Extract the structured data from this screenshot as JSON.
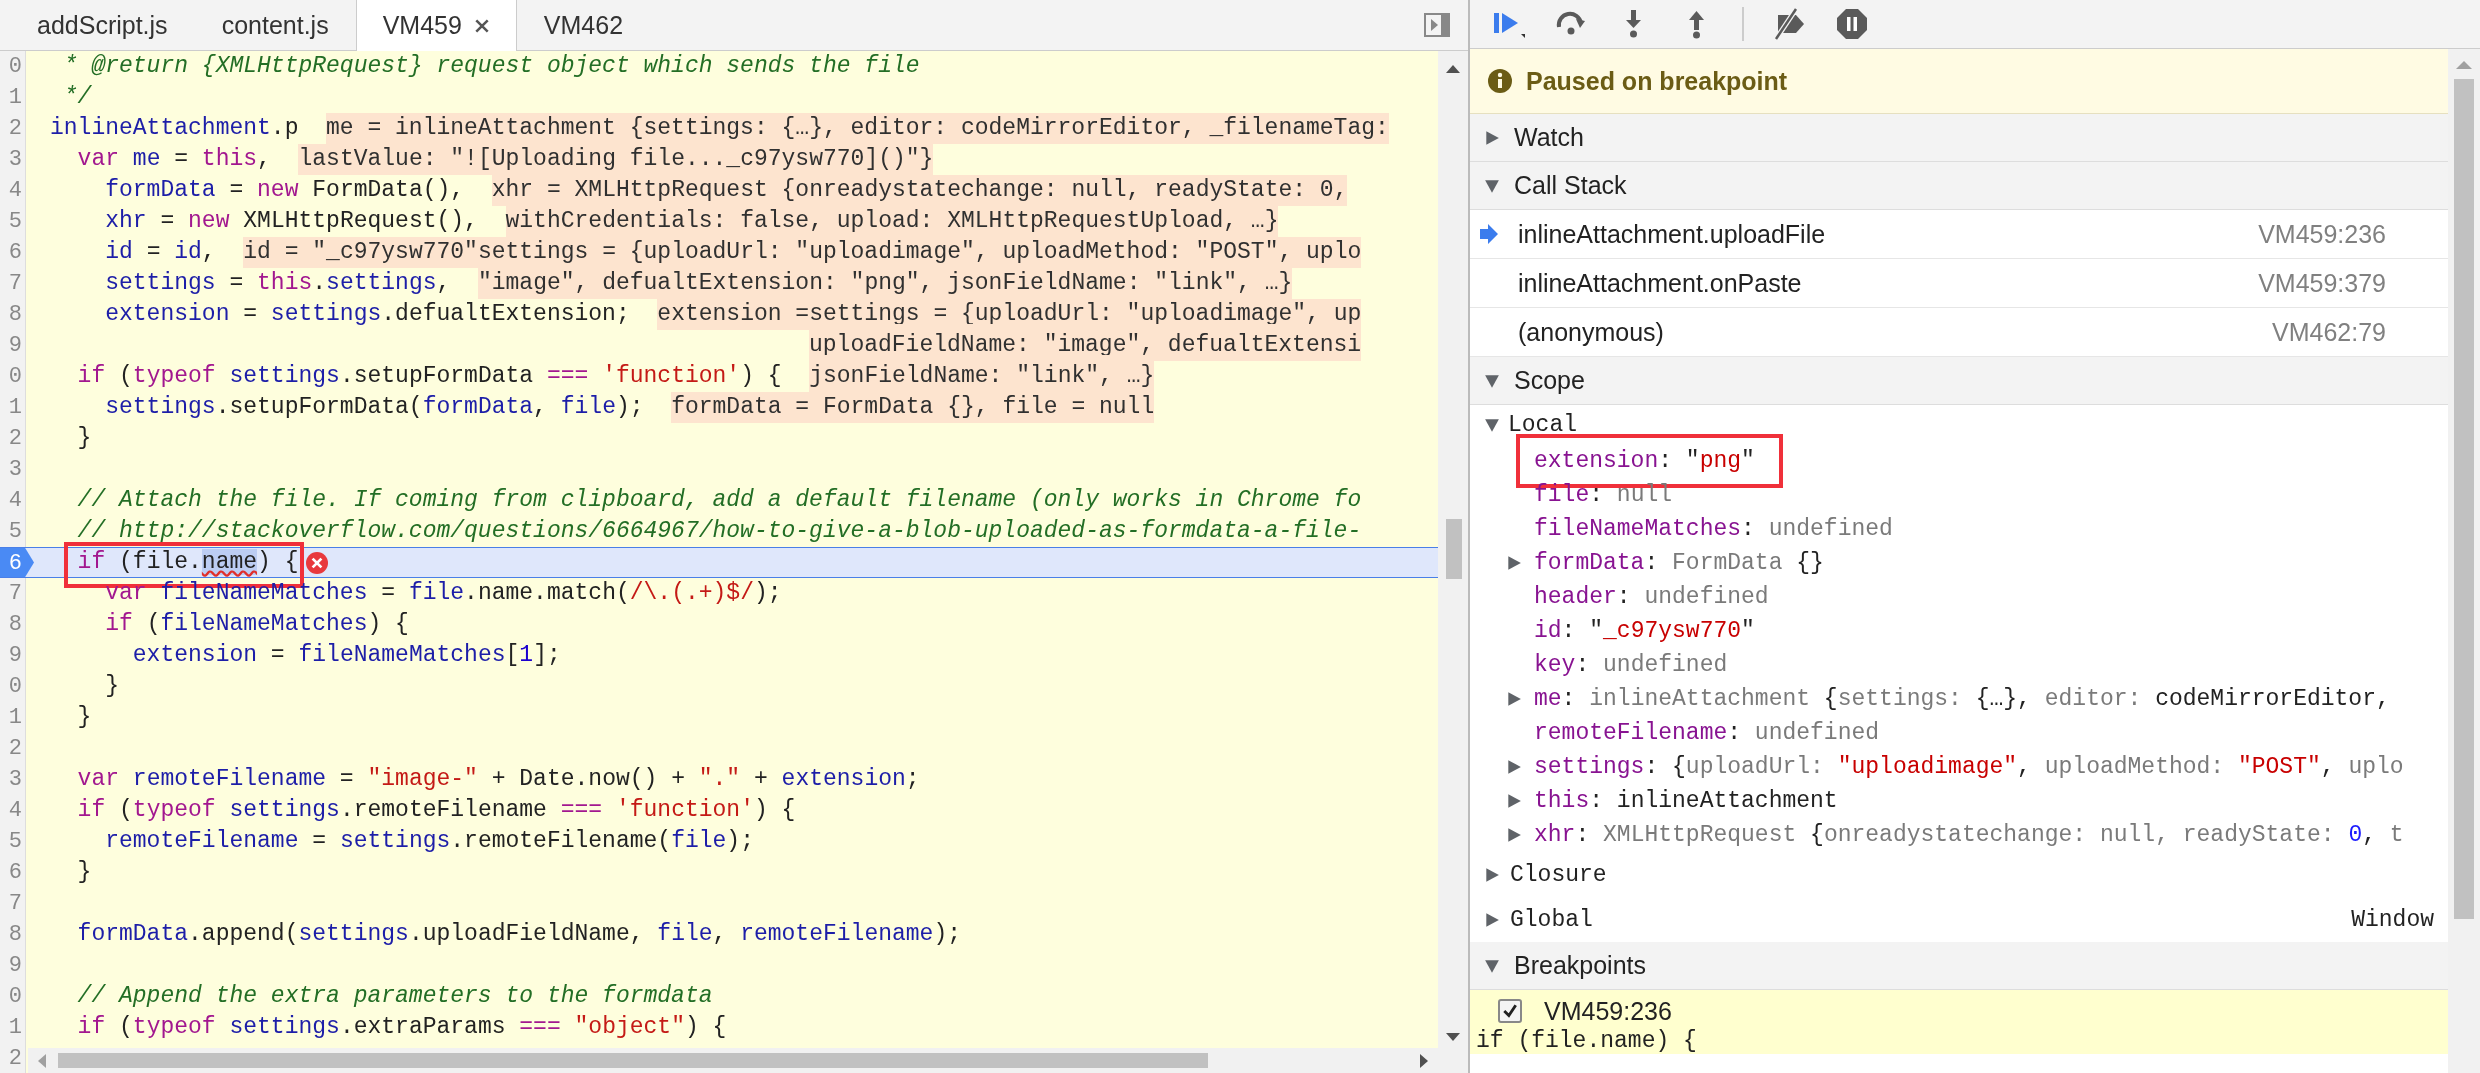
{
  "editor": {
    "tabs": [
      {
        "label": "addScript.js",
        "selected": false,
        "closable": false
      },
      {
        "label": "content.js",
        "selected": false,
        "closable": false
      },
      {
        "label": "VM459",
        "selected": true,
        "closable": true
      },
      {
        "label": "VM462",
        "selected": false,
        "closable": false
      }
    ],
    "code_lines": [
      {
        "gutter": "0",
        "tokens": [
          {
            "kind": "cm",
            "text": " * @return {XMLHttpRequest} request object which sends the file"
          }
        ]
      },
      {
        "gutter": "1",
        "tokens": [
          {
            "kind": "cm",
            "text": " */"
          }
        ]
      },
      {
        "gutter": "2",
        "tokens": [
          {
            "kind": "id",
            "text": "inlineAttachment"
          },
          {
            "kind": "p",
            "text": ".p"
          }
        ],
        "values": [
          {
            "text": "me = inlineAttachment {settings: {…}, editor: codeMirrorEditor, _filenameTag:",
            "continues": false
          }
        ]
      },
      {
        "gutter": "3",
        "tokens": [
          {
            "kind": "kw",
            "text": "  var "
          },
          {
            "kind": "id",
            "text": "me"
          },
          {
            "kind": "p",
            "text": " = "
          },
          {
            "kind": "kw",
            "text": "this"
          },
          {
            "kind": "p",
            "text": ","
          }
        ],
        "values": [
          {
            "text": "lastValue: \"![Uploading file..._c97ysw770]()\"}",
            "continues": false
          }
        ]
      },
      {
        "gutter": "4",
        "tokens": [
          {
            "kind": "id",
            "text": "    formData"
          },
          {
            "kind": "p",
            "text": " = "
          },
          {
            "kind": "kw",
            "text": "new"
          },
          {
            "kind": "p",
            "text": " FormData(),"
          }
        ],
        "values": [
          {
            "text": "xhr = XMLHttpRequest {onreadystatechange: null, readyState: 0,",
            "continues": false
          }
        ]
      },
      {
        "gutter": "5",
        "tokens": [
          {
            "kind": "id",
            "text": "    xhr"
          },
          {
            "kind": "p",
            "text": " = "
          },
          {
            "kind": "kw",
            "text": "new"
          },
          {
            "kind": "p",
            "text": " XMLHttpRequest(),"
          }
        ],
        "values": [
          {
            "text": "withCredentials: false, upload: XMLHttpRequestUpload, …}",
            "continues": false
          }
        ]
      },
      {
        "gutter": "6",
        "tokens": [
          {
            "kind": "id",
            "text": "    id"
          },
          {
            "kind": "p",
            "text": " = "
          },
          {
            "kind": "id",
            "text": "id"
          },
          {
            "kind": "p",
            "text": ","
          }
        ],
        "values": [
          {
            "text": "id = \"_c97ysw770\"",
            "continues": false
          },
          {
            "text": "settings = {uploadUrl: \"uploadimage\", uploadMethod: \"POST\", uplo",
            "continues": false
          }
        ]
      },
      {
        "gutter": "7",
        "tokens": [
          {
            "kind": "id",
            "text": "    settings"
          },
          {
            "kind": "p",
            "text": " = "
          },
          {
            "kind": "kw",
            "text": "this"
          },
          {
            "kind": "p",
            "text": "."
          },
          {
            "kind": "id",
            "text": "settings"
          },
          {
            "kind": "p",
            "text": ","
          }
        ],
        "values": [
          {
            "text": "\"image\", defualtExtension: \"png\", jsonFieldName: \"link\", …}",
            "continues": false
          }
        ]
      },
      {
        "gutter": "8",
        "tokens": [
          {
            "kind": "id",
            "text": "    extension"
          },
          {
            "kind": "p",
            "text": " = "
          },
          {
            "kind": "id",
            "text": "settings"
          },
          {
            "kind": "p",
            "text": ".defualtExtension;"
          }
        ],
        "values": [
          {
            "text": "extension =",
            "continues": false
          },
          {
            "text": "settings = {uploadUrl: \"uploadimage\", up",
            "continues": false
          }
        ]
      },
      {
        "gutter": "9",
        "values": [
          {
            "text": "uploadFieldName: \"image\", defualtExtensi",
            "continues": true
          }
        ]
      },
      {
        "gutter": "0",
        "tokens": [
          {
            "kind": "kw",
            "text": "  if"
          },
          {
            "kind": "p",
            "text": " ("
          },
          {
            "kind": "kw",
            "text": "typeof "
          },
          {
            "kind": "id",
            "text": "settings"
          },
          {
            "kind": "p",
            "text": ".setupFormData "
          },
          {
            "kind": "kw",
            "text": "=== "
          },
          {
            "kind": "str",
            "text": "'function'"
          },
          {
            "kind": "p",
            "text": ") {"
          }
        ],
        "values": [
          {
            "text": "jsonFieldName: \"link\", …}",
            "continues": true
          }
        ]
      },
      {
        "gutter": "1",
        "tokens": [
          {
            "kind": "id",
            "text": "    settings"
          },
          {
            "kind": "p",
            "text": ".setupFormData("
          },
          {
            "kind": "id",
            "text": "formData"
          },
          {
            "kind": "p",
            "text": ", "
          },
          {
            "kind": "id",
            "text": "file"
          },
          {
            "kind": "p",
            "text": ");"
          }
        ],
        "values": [
          {
            "text": "formData = FormData {}, file = null",
            "continues": false
          }
        ]
      },
      {
        "gutter": "2",
        "tokens": [
          {
            "kind": "p",
            "text": "  }"
          }
        ]
      },
      {
        "gutter": "3"
      },
      {
        "gutter": "4",
        "tokens": [
          {
            "kind": "cm",
            "text": "  // Attach the file. If coming from clipboard, add a default filename (only works in Chrome fo"
          }
        ]
      },
      {
        "gutter": "5",
        "tokens": [
          {
            "kind": "cm",
            "text": "  // http://stackoverflow.com/questions/6664967/how-to-give-a-blob-uploaded-as-formdata-a-file-"
          }
        ]
      },
      {
        "gutter": "6",
        "tokens": [
          {
            "kind": "kw",
            "text": "  if"
          },
          {
            "kind": "p",
            "text": " (file."
          },
          {
            "kind": "selected",
            "text": "name"
          },
          {
            "kind": "p",
            "text": ") {"
          }
        ],
        "current": true,
        "breakpoint": true,
        "error": true,
        "annotated": true
      },
      {
        "gutter": "7",
        "tokens": [
          {
            "kind": "kw",
            "text": "    var "
          },
          {
            "kind": "id",
            "text": "fileNameMatches"
          },
          {
            "kind": "p",
            "text": " = "
          },
          {
            "kind": "id",
            "text": "file"
          },
          {
            "kind": "p",
            "text": ".name.match("
          },
          {
            "kind": "str",
            "text": "/\\.(.+)$/"
          },
          {
            "kind": "p",
            "text": ");"
          }
        ]
      },
      {
        "gutter": "8",
        "tokens": [
          {
            "kind": "kw",
            "text": "    if"
          },
          {
            "kind": "p",
            "text": " ("
          },
          {
            "kind": "id",
            "text": "fileNameMatches"
          },
          {
            "kind": "p",
            "text": ") {"
          }
        ]
      },
      {
        "gutter": "9",
        "tokens": [
          {
            "kind": "id",
            "text": "      extension"
          },
          {
            "kind": "p",
            "text": " = "
          },
          {
            "kind": "id",
            "text": "fileNameMatches"
          },
          {
            "kind": "p",
            "text": "["
          },
          {
            "kind": "num",
            "text": "1"
          },
          {
            "kind": "p",
            "text": "];"
          }
        ]
      },
      {
        "gutter": "0",
        "tokens": [
          {
            "kind": "p",
            "text": "    }"
          }
        ]
      },
      {
        "gutter": "1",
        "tokens": [
          {
            "kind": "p",
            "text": "  }"
          }
        ]
      },
      {
        "gutter": "2"
      },
      {
        "gutter": "3",
        "tokens": [
          {
            "kind": "kw",
            "text": "  var "
          },
          {
            "kind": "id",
            "text": "remoteFilename"
          },
          {
            "kind": "p",
            "text": " = "
          },
          {
            "kind": "str",
            "text": "\"image-\""
          },
          {
            "kind": "p",
            "text": " + Date.now() + "
          },
          {
            "kind": "str",
            "text": "\".\""
          },
          {
            "kind": "p",
            "text": " + "
          },
          {
            "kind": "id",
            "text": "extension"
          },
          {
            "kind": "p",
            "text": ";"
          }
        ]
      },
      {
        "gutter": "4",
        "tokens": [
          {
            "kind": "kw",
            "text": "  if"
          },
          {
            "kind": "p",
            "text": " ("
          },
          {
            "kind": "kw",
            "text": "typeof "
          },
          {
            "kind": "id",
            "text": "settings"
          },
          {
            "kind": "p",
            "text": ".remoteFilename "
          },
          {
            "kind": "kw",
            "text": "=== "
          },
          {
            "kind": "str",
            "text": "'function'"
          },
          {
            "kind": "p",
            "text": ") {"
          }
        ]
      },
      {
        "gutter": "5",
        "tokens": [
          {
            "kind": "id",
            "text": "    remoteFilename"
          },
          {
            "kind": "p",
            "text": " = "
          },
          {
            "kind": "id",
            "text": "settings"
          },
          {
            "kind": "p",
            "text": ".remoteFilename("
          },
          {
            "kind": "id",
            "text": "file"
          },
          {
            "kind": "p",
            "text": ");"
          }
        ]
      },
      {
        "gutter": "6",
        "tokens": [
          {
            "kind": "p",
            "text": "  }"
          }
        ]
      },
      {
        "gutter": "7"
      },
      {
        "gutter": "8",
        "tokens": [
          {
            "kind": "id",
            "text": "  formData"
          },
          {
            "kind": "p",
            "text": ".append("
          },
          {
            "kind": "id",
            "text": "settings"
          },
          {
            "kind": "p",
            "text": ".uploadFieldName, "
          },
          {
            "kind": "id",
            "text": "file"
          },
          {
            "kind": "p",
            "text": ", "
          },
          {
            "kind": "id",
            "text": "remoteFilename"
          },
          {
            "kind": "p",
            "text": ");"
          }
        ]
      },
      {
        "gutter": "9"
      },
      {
        "gutter": "0",
        "tokens": [
          {
            "kind": "cm",
            "text": "  // Append the extra parameters to the formdata"
          }
        ]
      },
      {
        "gutter": "1",
        "tokens": [
          {
            "kind": "kw",
            "text": "  if"
          },
          {
            "kind": "p",
            "text": " ("
          },
          {
            "kind": "kw",
            "text": "typeof "
          },
          {
            "kind": "id",
            "text": "settings"
          },
          {
            "kind": "p",
            "text": ".extraParams "
          },
          {
            "kind": "kw",
            "text": "=== "
          },
          {
            "kind": "str",
            "text": "\"object\""
          },
          {
            "kind": "p",
            "text": ") {"
          }
        ]
      },
      {
        "gutter": "2"
      }
    ]
  },
  "debugger": {
    "toolbar": [
      {
        "kind": "resume"
      },
      {
        "kind": "step_over"
      },
      {
        "kind": "step_into"
      },
      {
        "kind": "step_out"
      },
      {
        "kind": "separator"
      },
      {
        "kind": "deactivate"
      },
      {
        "kind": "pause_exceptions"
      }
    ],
    "status": "Paused on breakpoint",
    "sections": [
      {
        "kind": "watch",
        "title": "Watch",
        "expanded": false
      },
      {
        "kind": "call_stack",
        "title": "Call Stack",
        "expanded": true,
        "frames": [
          {
            "name": "inlineAttachment.uploadFile",
            "location": "VM459:236",
            "selected": true
          },
          {
            "name": "inlineAttachment.onPaste",
            "location": "VM459:379",
            "selected": false
          },
          {
            "name": "(anonymous)",
            "location": "VM462:79",
            "selected": false
          }
        ]
      },
      {
        "kind": "scope",
        "title": "Scope",
        "expanded": true,
        "scopes": [
          {
            "title": "Local",
            "expanded": true,
            "variables": [
              {
                "name": "extension",
                "value": [
                  {
                    "kind": "p",
                    "text": ": \""
                  },
                  {
                    "kind": "str",
                    "text": "png"
                  },
                  {
                    "kind": "p",
                    "text": "\""
                  }
                ],
                "annotated": true
              },
              {
                "name": "file",
                "value": [
                  {
                    "kind": "p",
                    "text": ": "
                  },
                  {
                    "kind": "dim",
                    "text": "null"
                  }
                ],
                "annotated": false
              },
              {
                "name": "fileNameMatches",
                "value": [
                  {
                    "kind": "p",
                    "text": ": "
                  },
                  {
                    "kind": "dim",
                    "text": "undefined"
                  }
                ],
                "annotated": false
              },
              {
                "name": "formData",
                "value": [
                  {
                    "kind": "p",
                    "text": ": "
                  },
                  {
                    "kind": "dim",
                    "text": "FormData "
                  },
                  {
                    "kind": "p",
                    "text": "{}"
                  }
                ],
                "expanded": false,
                "annotated": false
              },
              {
                "name": "header",
                "value": [
                  {
                    "kind": "p",
                    "text": ": "
                  },
                  {
                    "kind": "dim",
                    "text": "undefined"
                  }
                ],
                "annotated": false
              },
              {
                "name": "id",
                "value": [
                  {
                    "kind": "p",
                    "text": ": \""
                  },
                  {
                    "kind": "str",
                    "text": "_c97ysw770"
                  },
                  {
                    "kind": "p",
                    "text": "\""
                  }
                ],
                "annotated": false
              },
              {
                "name": "key",
                "value": [
                  {
                    "kind": "p",
                    "text": ": "
                  },
                  {
                    "kind": "dim",
                    "text": "undefined"
                  }
                ],
                "annotated": false
              },
              {
                "name": "me",
                "value": [
                  {
                    "kind": "p",
                    "text": ": "
                  },
                  {
                    "kind": "dim",
                    "text": "inlineAttachment "
                  },
                  {
                    "kind": "p",
                    "text": "{"
                  },
                  {
                    "kind": "dim",
                    "text": "settings: "
                  },
                  {
                    "kind": "p",
                    "text": "{…}, "
                  },
                  {
                    "kind": "dim",
                    "text": "editor: "
                  },
                  {
                    "kind": "p",
                    "text": "codeMirrorEditor,"
                  }
                ],
                "expanded": false,
                "annotated": false
              },
              {
                "name": "remoteFilename",
                "value": [
                  {
                    "kind": "p",
                    "text": ": "
                  },
                  {
                    "kind": "dim",
                    "text": "undefined"
                  }
                ],
                "annotated": false
              },
              {
                "name": "settings",
                "value": [
                  {
                    "kind": "p",
                    "text": ": {"
                  },
                  {
                    "kind": "dim",
                    "text": "uploadUrl: "
                  },
                  {
                    "kind": "str",
                    "text": "\"uploadimage\""
                  },
                  {
                    "kind": "p",
                    "text": ", "
                  },
                  {
                    "kind": "dim",
                    "text": "uploadMethod: "
                  },
                  {
                    "kind": "str",
                    "text": "\"POST\""
                  },
                  {
                    "kind": "p",
                    "text": ", "
                  },
                  {
                    "kind": "dim",
                    "text": "uplo"
                  }
                ],
                "expanded": false,
                "annotated": false
              },
              {
                "name": "this",
                "value": [
                  {
                    "kind": "p",
                    "text": ": inlineAttachment"
                  }
                ],
                "expanded": false,
                "annotated": false
              },
              {
                "name": "xhr",
                "value": [
                  {
                    "kind": "p",
                    "text": ": "
                  },
                  {
                    "kind": "dim",
                    "text": "XMLHttpRequest "
                  },
                  {
                    "kind": "p",
                    "text": "{"
                  },
                  {
                    "kind": "dim",
                    "text": "onreadystatechange: null, readyState: "
                  },
                  {
                    "kind": "num",
                    "text": "0"
                  },
                  {
                    "kind": "p",
                    "text": ", "
                  },
                  {
                    "kind": "dim",
                    "text": "t"
                  }
                ],
                "expanded": false,
                "annotated": false
              }
            ]
          },
          {
            "title": "Closure",
            "expanded": false
          },
          {
            "title": "Global",
            "expanded": false,
            "value": "Window"
          }
        ]
      },
      {
        "kind": "breakpoints",
        "title": "Breakpoints",
        "expanded": true,
        "items": [
          {
            "location": "VM459:236",
            "checked": true,
            "code": "if (file.name) {"
          }
        ]
      }
    ]
  }
}
